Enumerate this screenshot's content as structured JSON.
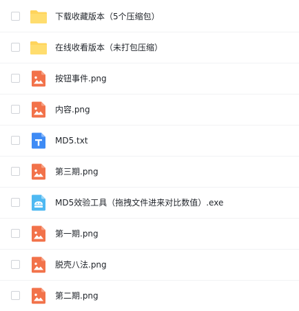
{
  "files": [
    {
      "name": "下载收藏版本（5个压缩包）",
      "icon": "folder-icon"
    },
    {
      "name": "在线收看版本（未打包压缩）",
      "icon": "folder-icon"
    },
    {
      "name": "按钮事件.png",
      "icon": "image-file-icon"
    },
    {
      "name": "内容.png",
      "icon": "image-file-icon"
    },
    {
      "name": "MD5.txt",
      "icon": "text-file-icon"
    },
    {
      "name": "第三期.png",
      "icon": "image-file-icon"
    },
    {
      "name": "MD5效验工具（拖拽文件进来对比数值）.exe",
      "icon": "executable-file-icon"
    },
    {
      "name": "第一期.png",
      "icon": "image-file-icon"
    },
    {
      "name": "脱壳八法.png",
      "icon": "image-file-icon"
    },
    {
      "name": "第二期.png",
      "icon": "image-file-icon"
    }
  ],
  "colors": {
    "folder": "#FFD45C",
    "image": "#F2724A",
    "text": "#3E8BF5",
    "executable": "#4FB9F2"
  }
}
